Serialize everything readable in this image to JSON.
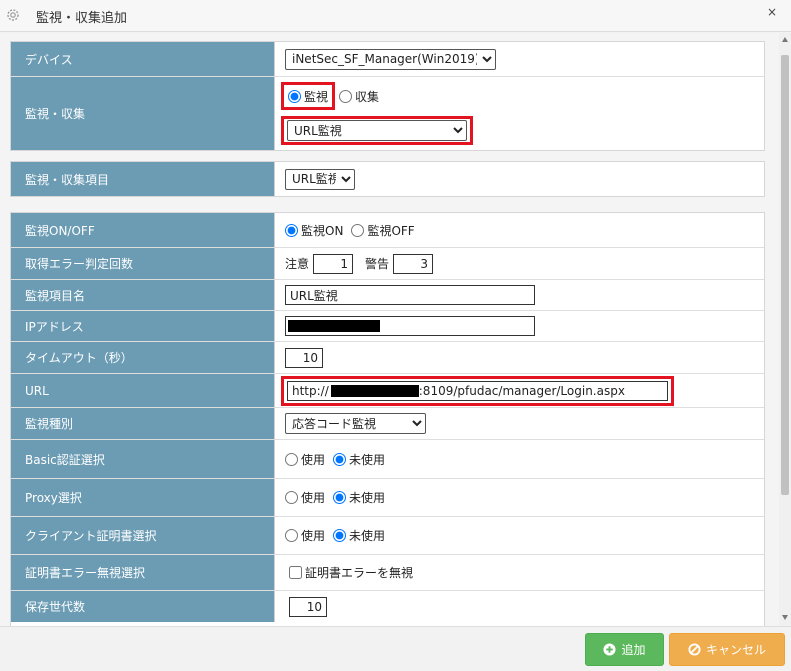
{
  "window": {
    "title": "監視・収集追加",
    "close_symbol": "×"
  },
  "device": {
    "label": "デバイス",
    "selected": "iNetSec_SF_Manager(Win2019)"
  },
  "monitor_collect": {
    "label": "監視・収集",
    "option_monitor": "監視",
    "option_collect": "収集",
    "selected_option": "監視",
    "type_selected": "URL監視"
  },
  "monitor_item": {
    "label": "監視・収集項目",
    "selected": "URL監視"
  },
  "fields": {
    "on_off": {
      "label": "監視ON/OFF",
      "option_on": "監視ON",
      "option_off": "監視OFF",
      "selected": "監視ON"
    },
    "error_count": {
      "label": "取得エラー判定回数",
      "caution_label": "注意",
      "caution_value": "1",
      "warning_label": "警告",
      "warning_value": "3"
    },
    "item_name": {
      "label": "監視項目名",
      "value": "URL監視"
    },
    "ip_address": {
      "label": "IPアドレス"
    },
    "timeout": {
      "label": "タイムアウト（秒）",
      "value": "10"
    },
    "url": {
      "label": "URL",
      "prefix": "http://",
      "suffix": ":8109/pfudac/manager/Login.aspx"
    },
    "monitor_type": {
      "label": "監視種別",
      "selected": "応答コード監視"
    },
    "basic_auth": {
      "label": "Basic認証選択",
      "option_use": "使用",
      "option_unused": "未使用",
      "selected": "未使用"
    },
    "proxy": {
      "label": "Proxy選択",
      "option_use": "使用",
      "option_unused": "未使用",
      "selected": "未使用"
    },
    "client_cert": {
      "label": "クライアント証明書選択",
      "option_use": "使用",
      "option_unused": "未使用",
      "selected": "未使用"
    },
    "cert_error": {
      "label": "証明書エラー無視選択",
      "checkbox_label": "証明書エラーを無視",
      "checked": false
    },
    "generations": {
      "label": "保存世代数",
      "value": "10"
    }
  },
  "buttons": {
    "add": "追加",
    "cancel": "キャンセル"
  },
  "colors": {
    "label_bg": "#6b9cb4",
    "highlight": "#e3141f",
    "add": "#5cb85c",
    "cancel": "#f0ad4e"
  }
}
